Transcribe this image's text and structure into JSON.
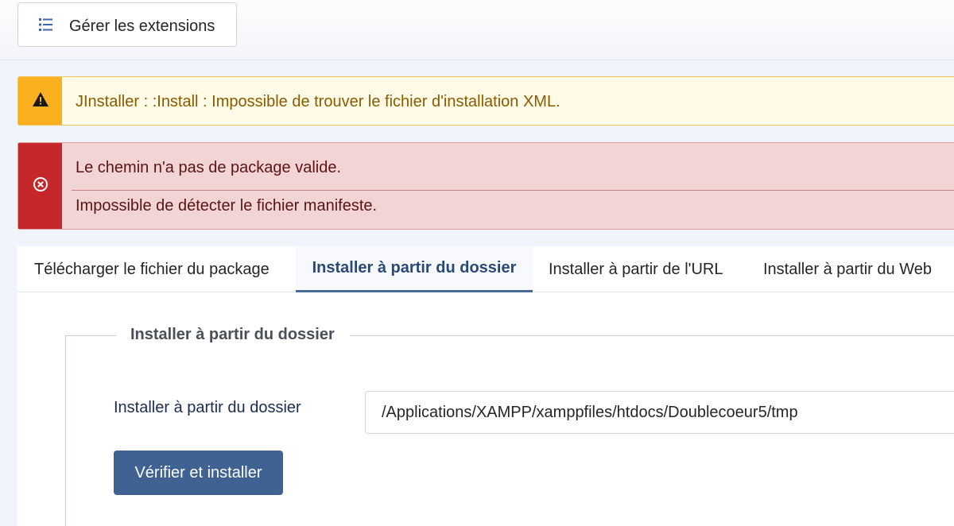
{
  "toolbar": {
    "manage_label": "Gérer les extensions",
    "manage_icon": "list-icon"
  },
  "alerts": {
    "warning": {
      "icon": "warning-triangle-icon",
      "message": "JInstaller : :Install : Impossible de trouver le fichier d'installation XML."
    },
    "error": {
      "icon": "circle-x-icon",
      "messages": [
        "Le chemin n'a pas de package valide.",
        "Impossible de détecter le fichier manifeste."
      ]
    }
  },
  "tabs": [
    {
      "label": "Télécharger le fichier du package",
      "active": false
    },
    {
      "label": "Installer à partir du dossier",
      "active": true
    },
    {
      "label": "Installer à partir de l'URL",
      "active": false
    },
    {
      "label": "Installer à partir du Web",
      "active": false
    }
  ],
  "form": {
    "legend": "Installer à partir du dossier",
    "field_label": "Installer à partir du dossier",
    "path_value": "/Applications/XAMPP/xamppfiles/htdocs/Doublecoeur5/tmp",
    "submit_label": "Vérifier et installer"
  },
  "colors": {
    "warning_accent": "#fbb020",
    "error_accent": "#c6272b",
    "primary": "#3f6293",
    "active_tab": "#2a4a75"
  }
}
